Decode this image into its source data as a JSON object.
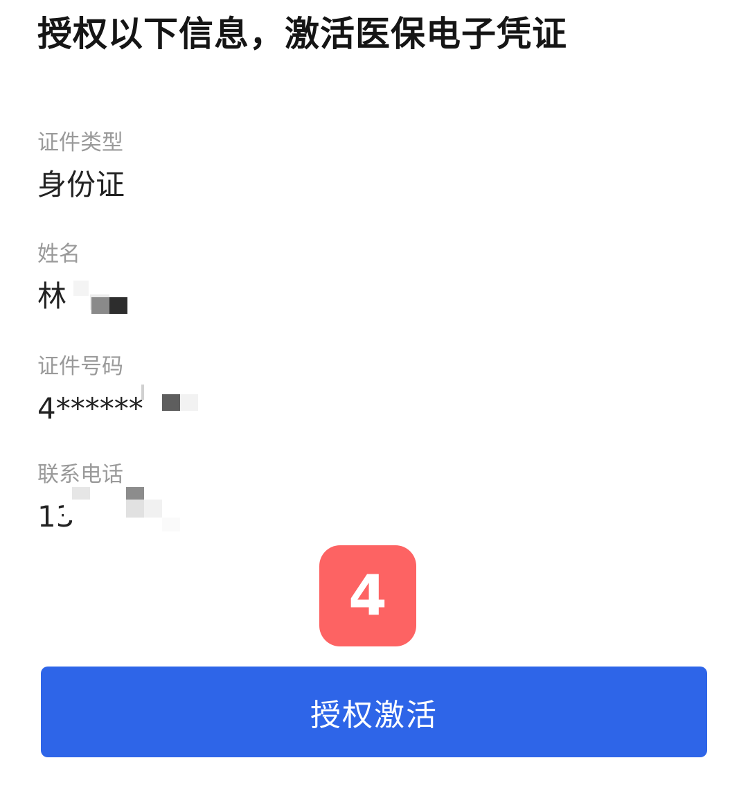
{
  "header": {
    "title": "授权以下信息，激活医保电子凭证"
  },
  "fields": {
    "id_type": {
      "label": "证件类型",
      "value": "身份证"
    },
    "name": {
      "label": "姓名",
      "value": "林"
    },
    "id_number": {
      "label": "证件号码",
      "value": "4******"
    },
    "phone": {
      "label": "联系电话",
      "value": "13"
    }
  },
  "badge": {
    "text": "4",
    "color": "#fd6363"
  },
  "actions": {
    "activate_label": "授权激活",
    "color": "#2e65e8"
  }
}
